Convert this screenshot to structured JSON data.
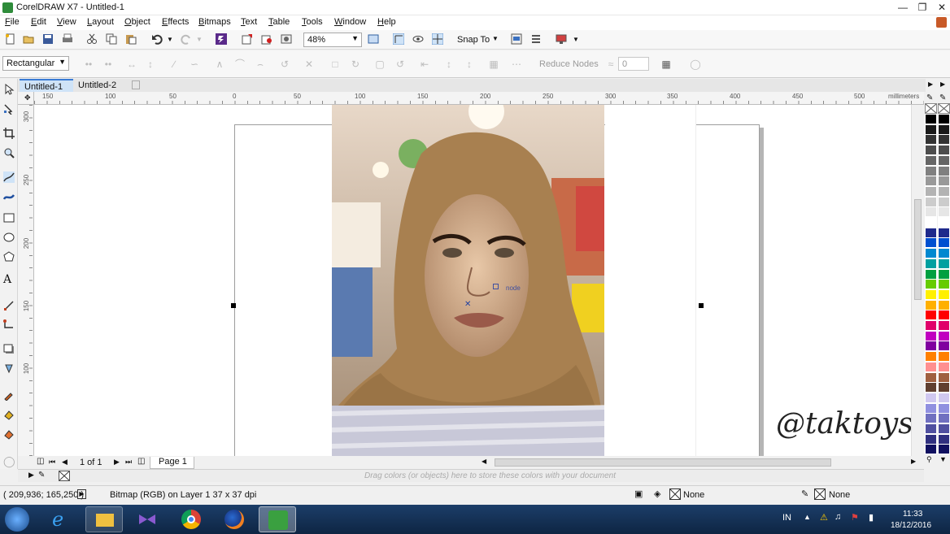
{
  "window": {
    "title": "CorelDRAW X7 - Untitled-1",
    "controls": [
      "minimize-icon",
      "restore-icon",
      "close-icon"
    ]
  },
  "menu": [
    "File",
    "Edit",
    "View",
    "Layout",
    "Object",
    "Effects",
    "Bitmaps",
    "Text",
    "Table",
    "Tools",
    "Window",
    "Help"
  ],
  "toolbar": {
    "zoom": "48%",
    "snap_to": "Snap To"
  },
  "property_bar": {
    "shape_mode": "Rectangular",
    "reduce_nodes": "Reduce Nodes",
    "smoothing_value": "0"
  },
  "tabs": [
    {
      "label": "Untitled-1",
      "active": true
    },
    {
      "label": "Untitled-2",
      "active": false
    }
  ],
  "ruler": {
    "units": "millimeters",
    "h_ticks": [
      "150",
      "100",
      "50",
      "0",
      "50",
      "100",
      "150",
      "200",
      "250",
      "300",
      "350",
      "400",
      "450",
      "500"
    ],
    "v_ticks": [
      "300",
      "250",
      "200",
      "150",
      "100"
    ]
  },
  "canvas": {
    "node_label": "node",
    "watermark": "@taktoys"
  },
  "page_nav": {
    "counter": "1 of 1",
    "page_tab": "Page 1"
  },
  "doc_palette_hint": "Drag colors (or objects) here to store these colors with your document",
  "status": {
    "coords": "( 209,936; 165,250 )",
    "object_info": "Bitmap (RGB) on Layer 1 37 x 37 dpi",
    "fill": "None",
    "outline": "None"
  },
  "palette_colors": [
    "#000000",
    "#1a1a1a",
    "#333333",
    "#4d4d4d",
    "#666666",
    "#808080",
    "#999999",
    "#b3b3b3",
    "#cccccc",
    "#e6e6e6",
    "#ffffff",
    "#1f2a8c",
    "#0050d0",
    "#0088d0",
    "#00a0a0",
    "#00a040",
    "#66cc00",
    "#fff000",
    "#ffb000",
    "#ff0000",
    "#e0006a",
    "#c000c0",
    "#8000a0",
    "#ff8000",
    "#ff9090",
    "#a06040",
    "#604030",
    "#d0c8f0",
    "#9090e0",
    "#7070c0",
    "#5050a0",
    "#303080",
    "#101060"
  ],
  "taskbar": {
    "apps": [
      "windows-start",
      "internet-explorer",
      "file-explorer",
      "visual-studio",
      "chrome",
      "firefox",
      "coreldraw"
    ],
    "lang": "IN",
    "time": "11:33",
    "date": "18/12/2016"
  }
}
